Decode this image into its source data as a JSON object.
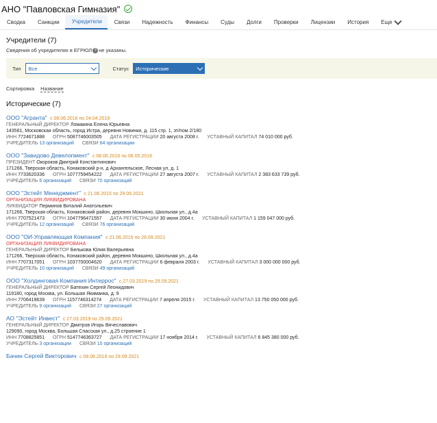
{
  "header": {
    "title": "АНО \"Павловская Гимназия\""
  },
  "tabs": [
    {
      "label": "Сводка"
    },
    {
      "label": "Санкции"
    },
    {
      "label": "Учредители"
    },
    {
      "label": "Связи"
    },
    {
      "label": "Надежность"
    },
    {
      "label": "Финансы"
    },
    {
      "label": "Суды"
    },
    {
      "label": "Долги"
    },
    {
      "label": "Проверки"
    },
    {
      "label": "Лицензии"
    },
    {
      "label": "История"
    },
    {
      "label": "Еще"
    }
  ],
  "section": {
    "title": "Учредители (7)",
    "note_before": "Сведения об учредителях в ЕГРЮЛ",
    "note_after": "не указаны."
  },
  "filters": {
    "type_label": "Тип",
    "type_value": "Все",
    "status_label": "Статус",
    "status_value": "Исторические"
  },
  "sort": {
    "label": "Сортировка",
    "value": "Название"
  },
  "group": {
    "title": "Исторические (7)"
  },
  "labels": {
    "inn": "ИНН",
    "ogrn": "ОГРН",
    "reg": "Дата регистрации",
    "capital": "Уставный капитал",
    "founder": "Учредитель",
    "links": "Связи"
  },
  "entries": [
    {
      "name": "ООО \"Агранта\"",
      "dates": "с 08.06.2016 по 24.04.2019",
      "role": "Генеральный директор",
      "person": "Ломакина Елена Юрьевна",
      "address": "143581, Московская область, город Истра, деревня Новинки, д. 115 стр. 1, эт/пом 2/180",
      "inn": "7724671888",
      "ogrn": "5087746003505",
      "reg": "20 августа 2008 г.",
      "capital": "74 010 000 руб.",
      "founders": "13 организаций",
      "links": "64 организации"
    },
    {
      "name": "ООО \"Завидово Девелопмент\"",
      "dates": "с 08.06.2016 по 06.05.2019",
      "role": "Президент",
      "person": "Окороков Дмитрий Константинович",
      "address": "171266, Тверская область, Конаковский р-н, д Архангельское, Лесная ул, д. 1",
      "inn": "7733620336",
      "ogrn": "1077759454222",
      "reg": "27 августа 2007 г.",
      "capital": "2 383 633 739 руб.",
      "founders": "6 организаций",
      "links": "70 организаций"
    },
    {
      "name": "ООО \"Эстейт Менеджмент\"",
      "dates": "с 21.06.2015 по 29.09.2021",
      "liquidated": "Организация ликвидирована",
      "role": "Ликвидатор",
      "person": "Перминов Виталий Анатольевич",
      "address": "171266, Тверская область, Конаковский район, деревня Мокшино, Школьная ул., д.4а",
      "inn": "7707521473",
      "ogrn": "1047796471557",
      "reg": "30 июня 2004 г.",
      "capital": "1 159 047 000 руб.",
      "founders": "12 организаций",
      "links": "76 организаций"
    },
    {
      "name": "ООО \"ОИ-Управляющая Компания\"",
      "dates": "с 21.06.2015 по 29.09.2021",
      "liquidated": "Организация ликвидирована",
      "role": "Генеральный директор",
      "person": "Белькова Юлия Валерьевна",
      "address": "171266, Тверская область, Конаковский район, деревня Мокшино, Школьная ул., д.4а",
      "inn": "7707317051",
      "ogrn": "1037700004620",
      "reg": "6 февраля 2003 г.",
      "capital": "3 000 000 000 руб.",
      "founders": "10 организаций",
      "links": "49 организаций"
    },
    {
      "name": "ООО \"Холдинговая Компания Интеррос\"",
      "dates": "с 27.03.2019 по 29.09.2021",
      "role": "Генеральный директор",
      "person": "Батехин Сергей Леонидович",
      "address": "119180, город Москва, ул. Большая Якиманка, д. 9",
      "inn": "7706419639",
      "ogrn": "1157746314274",
      "reg": "7 апреля 2015 г.",
      "capital": "13 750 050 000 руб.",
      "founders": "9 организаций",
      "links": "27 организаций"
    },
    {
      "name": "АО \"Эстейт Инвест\"",
      "dates": "с 27.03.2019 по 29.09.2021",
      "role": "Генеральный директор",
      "person": "Дмитров Игорь Вячеславович",
      "address": "129090, город Москва, Большая Спасская ул., д.25 строение 1",
      "inn": "7708825851",
      "ogrn": "5147746363727",
      "reg": "17 ноября 2014 г.",
      "capital": "6 845 380 000 руб.",
      "founders": "3 организации",
      "links": "10 организаций"
    },
    {
      "name": "Бачин Сергей Викторович",
      "dates": "с 08.06.2016 по 29.09.2021"
    }
  ]
}
